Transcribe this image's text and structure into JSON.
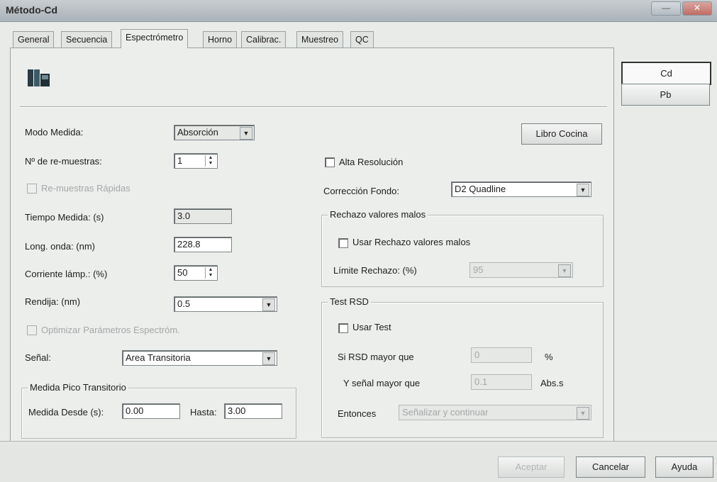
{
  "window": {
    "title": "Método-Cd"
  },
  "tabs": [
    {
      "label": "General"
    },
    {
      "label": "Secuencia"
    },
    {
      "label": "Espectrómetro"
    },
    {
      "label": "Horno"
    },
    {
      "label": "Calibrac."
    },
    {
      "label": "Muestreo"
    },
    {
      "label": "QC"
    }
  ],
  "icon": "book-icon",
  "left": {
    "modo_medida": {
      "label": "Modo Medida:",
      "value": "Absorción"
    },
    "re_muestras": {
      "label": "Nº de re-muestras:",
      "value": "1"
    },
    "re_rapidas": {
      "label": "Re-muestras Rápidas"
    },
    "tiempo": {
      "label": "Tiempo Medida: (s)",
      "value": "3.0"
    },
    "long_onda": {
      "label": "Long. onda: (nm)",
      "value": "228.8"
    },
    "corriente": {
      "label": "Corriente lámp.: (%)",
      "value": "50"
    },
    "rendija": {
      "label": "Rendija: (nm)",
      "value": "0.5"
    },
    "optimizar": {
      "label": "Optimizar Parámetros Espectróm."
    },
    "senal": {
      "label": "Señal:",
      "value": "Area Transitoria"
    },
    "pico": {
      "title": "Medida Pico Transitorio",
      "desde_label": "Medida Desde (s):",
      "desde_value": "0.00",
      "hasta_label": "Hasta:",
      "hasta_value": "3.00"
    }
  },
  "right": {
    "libro_cocina": "Libro Cocina",
    "alta_res": {
      "label": "Alta Resolución"
    },
    "correccion": {
      "label": "Corrección Fondo:",
      "value": "D2 Quadline"
    },
    "rechazo": {
      "title": "Rechazo valores malos",
      "usar_label": "Usar Rechazo valores malos",
      "limite_label": "Límite Rechazo: (%)",
      "limite_value": "95"
    },
    "rsd": {
      "title": "Test RSD",
      "usar_label": "Usar Test",
      "si_label": "Si RSD mayor que",
      "si_value": "0",
      "si_unit": "%",
      "y_label": "Y señal mayor que",
      "y_value": "0.1",
      "y_unit": "Abs.s",
      "entonces_label": "Entonces",
      "entonces_value": "Señalizar y continuar"
    }
  },
  "elements": [
    {
      "label": "Cd"
    },
    {
      "label": "Pb"
    }
  ],
  "footer": {
    "aceptar": "Aceptar",
    "cancelar": "Cancelar",
    "ayuda": "Ayuda"
  }
}
